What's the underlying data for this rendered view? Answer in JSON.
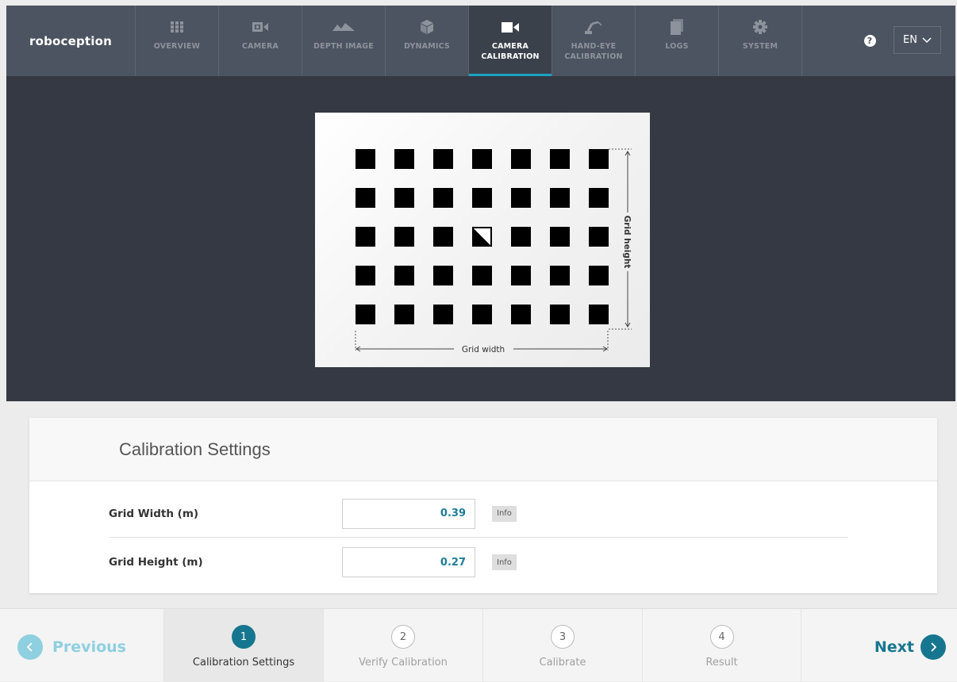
{
  "brand": {
    "name": "roboception"
  },
  "nav": [
    {
      "label": "OVERVIEW",
      "icon": "grid-icon",
      "active": false
    },
    {
      "label": "CAMERA",
      "icon": "camera-icon",
      "active": false
    },
    {
      "label": "DEPTH IMAGE",
      "icon": "depth-icon",
      "active": false
    },
    {
      "label": "DYNAMICS",
      "icon": "cube-icon",
      "active": false
    },
    {
      "label": "CAMERA CALIBRATION",
      "icon": "video-icon",
      "active": true
    },
    {
      "label": "HAND-EYE CALIBRATION",
      "icon": "robot-arm-icon",
      "active": false
    },
    {
      "label": "LOGS",
      "icon": "file-icon",
      "active": false
    },
    {
      "label": "SYSTEM",
      "icon": "gear-icon",
      "active": false
    }
  ],
  "help": {
    "icon": "help-icon",
    "glyph": "?"
  },
  "language": {
    "value": "EN"
  },
  "board": {
    "rows": 5,
    "cols": 7,
    "marker": {
      "row": 2,
      "col": 3
    },
    "width_label": "Grid width",
    "height_label": "Grid height"
  },
  "settings": {
    "title": "Calibration Settings",
    "fields": [
      {
        "label": "Grid Width (m)",
        "value": "0.39",
        "info": "Info"
      },
      {
        "label": "Grid Height (m)",
        "value": "0.27",
        "info": "Info"
      }
    ]
  },
  "wizard": {
    "previous": "Previous",
    "next": "Next",
    "steps": [
      {
        "num": "1",
        "label": "Calibration Settings",
        "active": true
      },
      {
        "num": "2",
        "label": "Verify Calibration",
        "active": false
      },
      {
        "num": "3",
        "label": "Calibrate",
        "active": false
      },
      {
        "num": "4",
        "label": "Result",
        "active": false
      }
    ]
  },
  "colors": {
    "accent": "#17768f",
    "nav_bg": "#4c5461",
    "viewer_bg": "#343943",
    "active_underline": "#1ba2c2"
  }
}
